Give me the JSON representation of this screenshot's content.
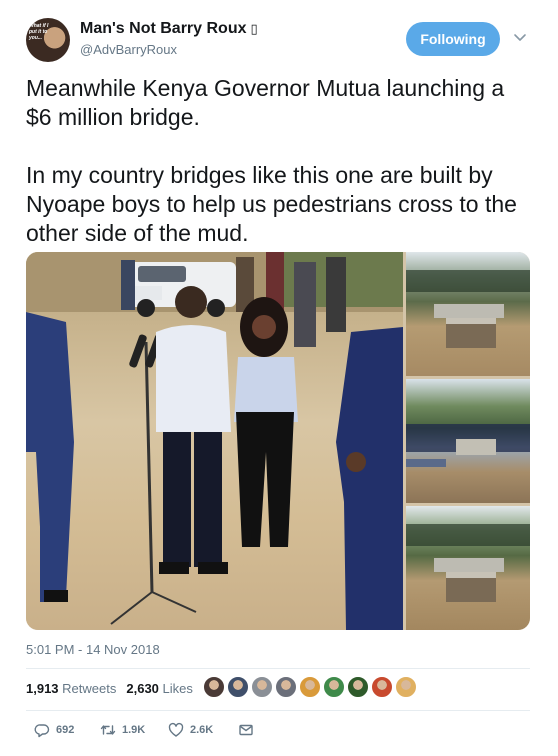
{
  "header": {
    "display_name": "Man's Not Barry Roux",
    "name_badge": "▯",
    "handle": "@AdvBarryRoux",
    "avatar_text": "What if I put it to you...",
    "follow_label": "Following",
    "caret_icon": "chevron-down-icon"
  },
  "tweet": {
    "paragraphs": [
      "Meanwhile Kenya Governor Mutua launching a $6 million bridge.",
      "In my country bridges like this one are built by Nyoape boys to help us pedestrians cross to the other side of the mud."
    ]
  },
  "media": {
    "count": 4,
    "main": "group standing at microphones on dirt road with white pickup",
    "thumbs": [
      "small concrete culvert bridge with crowd",
      "crowd gathered at bridge",
      "small concrete culvert bridge with crowd"
    ]
  },
  "meta": {
    "timestamp": "5:01 PM - 14 Nov 2018",
    "retweets_count": "1,913",
    "retweets_label": "Retweets",
    "likes_count": "2,630",
    "likes_label": "Likes",
    "liker_colors": [
      "#4a3a36",
      "#3f4f6a",
      "#8a8f96",
      "#6b6f7a",
      "#d99a3a",
      "#3f8a4a",
      "#2e5a2a",
      "#c84a2e",
      "#e0b060"
    ]
  },
  "actions": {
    "reply_count": "692",
    "retweet_count": "1.9K",
    "like_count": "2.6K"
  },
  "colors": {
    "accent": "#1da1f2",
    "follow_bg": "#5aa9e8",
    "muted": "#657786",
    "text": "#14171a"
  }
}
